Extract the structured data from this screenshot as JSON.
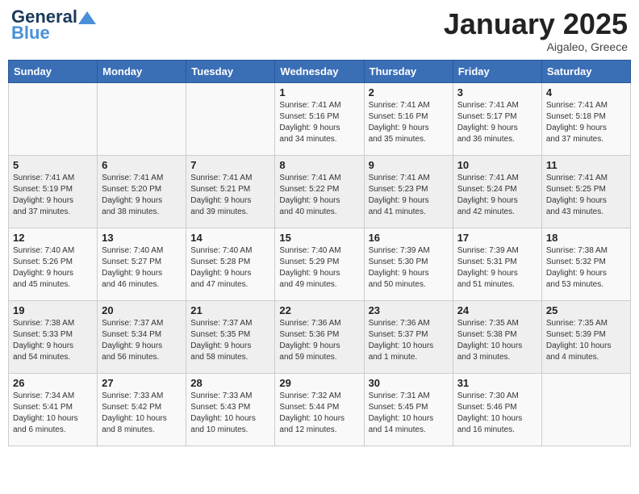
{
  "header": {
    "logo_line1": "General",
    "logo_line2": "Blue",
    "month": "January 2025",
    "location": "Aigaleo, Greece"
  },
  "weekdays": [
    "Sunday",
    "Monday",
    "Tuesday",
    "Wednesday",
    "Thursday",
    "Friday",
    "Saturday"
  ],
  "weeks": [
    [
      {
        "day": "",
        "info": ""
      },
      {
        "day": "",
        "info": ""
      },
      {
        "day": "",
        "info": ""
      },
      {
        "day": "1",
        "info": "Sunrise: 7:41 AM\nSunset: 5:16 PM\nDaylight: 9 hours\nand 34 minutes."
      },
      {
        "day": "2",
        "info": "Sunrise: 7:41 AM\nSunset: 5:16 PM\nDaylight: 9 hours\nand 35 minutes."
      },
      {
        "day": "3",
        "info": "Sunrise: 7:41 AM\nSunset: 5:17 PM\nDaylight: 9 hours\nand 36 minutes."
      },
      {
        "day": "4",
        "info": "Sunrise: 7:41 AM\nSunset: 5:18 PM\nDaylight: 9 hours\nand 37 minutes."
      }
    ],
    [
      {
        "day": "5",
        "info": "Sunrise: 7:41 AM\nSunset: 5:19 PM\nDaylight: 9 hours\nand 37 minutes."
      },
      {
        "day": "6",
        "info": "Sunrise: 7:41 AM\nSunset: 5:20 PM\nDaylight: 9 hours\nand 38 minutes."
      },
      {
        "day": "7",
        "info": "Sunrise: 7:41 AM\nSunset: 5:21 PM\nDaylight: 9 hours\nand 39 minutes."
      },
      {
        "day": "8",
        "info": "Sunrise: 7:41 AM\nSunset: 5:22 PM\nDaylight: 9 hours\nand 40 minutes."
      },
      {
        "day": "9",
        "info": "Sunrise: 7:41 AM\nSunset: 5:23 PM\nDaylight: 9 hours\nand 41 minutes."
      },
      {
        "day": "10",
        "info": "Sunrise: 7:41 AM\nSunset: 5:24 PM\nDaylight: 9 hours\nand 42 minutes."
      },
      {
        "day": "11",
        "info": "Sunrise: 7:41 AM\nSunset: 5:25 PM\nDaylight: 9 hours\nand 43 minutes."
      }
    ],
    [
      {
        "day": "12",
        "info": "Sunrise: 7:40 AM\nSunset: 5:26 PM\nDaylight: 9 hours\nand 45 minutes."
      },
      {
        "day": "13",
        "info": "Sunrise: 7:40 AM\nSunset: 5:27 PM\nDaylight: 9 hours\nand 46 minutes."
      },
      {
        "day": "14",
        "info": "Sunrise: 7:40 AM\nSunset: 5:28 PM\nDaylight: 9 hours\nand 47 minutes."
      },
      {
        "day": "15",
        "info": "Sunrise: 7:40 AM\nSunset: 5:29 PM\nDaylight: 9 hours\nand 49 minutes."
      },
      {
        "day": "16",
        "info": "Sunrise: 7:39 AM\nSunset: 5:30 PM\nDaylight: 9 hours\nand 50 minutes."
      },
      {
        "day": "17",
        "info": "Sunrise: 7:39 AM\nSunset: 5:31 PM\nDaylight: 9 hours\nand 51 minutes."
      },
      {
        "day": "18",
        "info": "Sunrise: 7:38 AM\nSunset: 5:32 PM\nDaylight: 9 hours\nand 53 minutes."
      }
    ],
    [
      {
        "day": "19",
        "info": "Sunrise: 7:38 AM\nSunset: 5:33 PM\nDaylight: 9 hours\nand 54 minutes."
      },
      {
        "day": "20",
        "info": "Sunrise: 7:37 AM\nSunset: 5:34 PM\nDaylight: 9 hours\nand 56 minutes."
      },
      {
        "day": "21",
        "info": "Sunrise: 7:37 AM\nSunset: 5:35 PM\nDaylight: 9 hours\nand 58 minutes."
      },
      {
        "day": "22",
        "info": "Sunrise: 7:36 AM\nSunset: 5:36 PM\nDaylight: 9 hours\nand 59 minutes."
      },
      {
        "day": "23",
        "info": "Sunrise: 7:36 AM\nSunset: 5:37 PM\nDaylight: 10 hours\nand 1 minute."
      },
      {
        "day": "24",
        "info": "Sunrise: 7:35 AM\nSunset: 5:38 PM\nDaylight: 10 hours\nand 3 minutes."
      },
      {
        "day": "25",
        "info": "Sunrise: 7:35 AM\nSunset: 5:39 PM\nDaylight: 10 hours\nand 4 minutes."
      }
    ],
    [
      {
        "day": "26",
        "info": "Sunrise: 7:34 AM\nSunset: 5:41 PM\nDaylight: 10 hours\nand 6 minutes."
      },
      {
        "day": "27",
        "info": "Sunrise: 7:33 AM\nSunset: 5:42 PM\nDaylight: 10 hours\nand 8 minutes."
      },
      {
        "day": "28",
        "info": "Sunrise: 7:33 AM\nSunset: 5:43 PM\nDaylight: 10 hours\nand 10 minutes."
      },
      {
        "day": "29",
        "info": "Sunrise: 7:32 AM\nSunset: 5:44 PM\nDaylight: 10 hours\nand 12 minutes."
      },
      {
        "day": "30",
        "info": "Sunrise: 7:31 AM\nSunset: 5:45 PM\nDaylight: 10 hours\nand 14 minutes."
      },
      {
        "day": "31",
        "info": "Sunrise: 7:30 AM\nSunset: 5:46 PM\nDaylight: 10 hours\nand 16 minutes."
      },
      {
        "day": "",
        "info": ""
      }
    ]
  ]
}
